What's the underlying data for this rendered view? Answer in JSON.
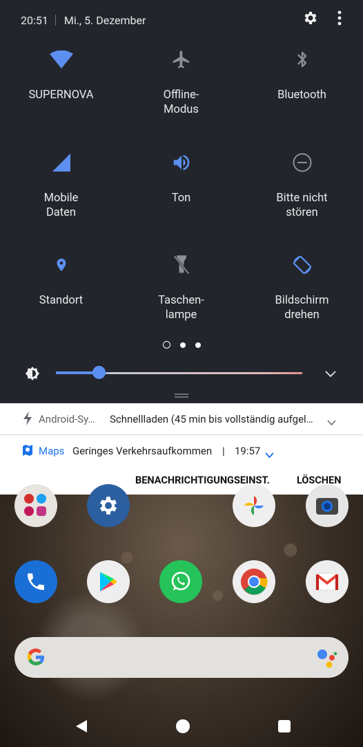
{
  "status_bar": {
    "time": "20:51",
    "date": "Mi., 5. Dezember",
    "icons": [
      "gear-icon",
      "more-vert-icon"
    ]
  },
  "tiles": [
    {
      "label_lines": [
        "SUPERNOVA"
      ],
      "icon": "wifi-icon",
      "active": true
    },
    {
      "label_lines": [
        "Offline-",
        "Modus"
      ],
      "icon": "airplane-icon",
      "active": false
    },
    {
      "label_lines": [
        "Bluetooth"
      ],
      "icon": "bluetooth-icon",
      "active": false
    },
    {
      "label_lines": [
        "Mobile",
        "Daten"
      ],
      "icon": "signal-icon",
      "active": true
    },
    {
      "label_lines": [
        "Ton"
      ],
      "icon": "volume-icon",
      "active": true
    },
    {
      "label_lines": [
        "Bitte nicht",
        "stören"
      ],
      "icon": "dnd-icon",
      "active": false
    },
    {
      "label_lines": [
        "Standort"
      ],
      "icon": "location-icon",
      "active": true
    },
    {
      "label_lines": [
        "Taschen-",
        "lampe"
      ],
      "icon": "flashlight-icon",
      "active": false
    },
    {
      "label_lines": [
        "Bildschirm",
        "drehen"
      ],
      "icon": "rotate-icon",
      "active": true
    }
  ],
  "pager": {
    "pages": 3,
    "current": 2
  },
  "brightness": {
    "level": 0.18
  },
  "notifications": [
    {
      "app": "Android-Sy…",
      "text": "Schnellladen (45 min bis vollständig aufgel…",
      "icon": "bolt-icon"
    },
    {
      "app": "Maps",
      "text": "Geringes Verkehrsaufkommen",
      "separator": "|",
      "time": "19:57",
      "icon": "maps-icon"
    }
  ],
  "actions": {
    "settings": "BENACHRICHTIGUNGSEINST.",
    "clear": "LÖSCHEN"
  },
  "colors": {
    "accent": "#5c8fef",
    "panel": "#23252c",
    "inactive_icon": "#8d8f95"
  }
}
